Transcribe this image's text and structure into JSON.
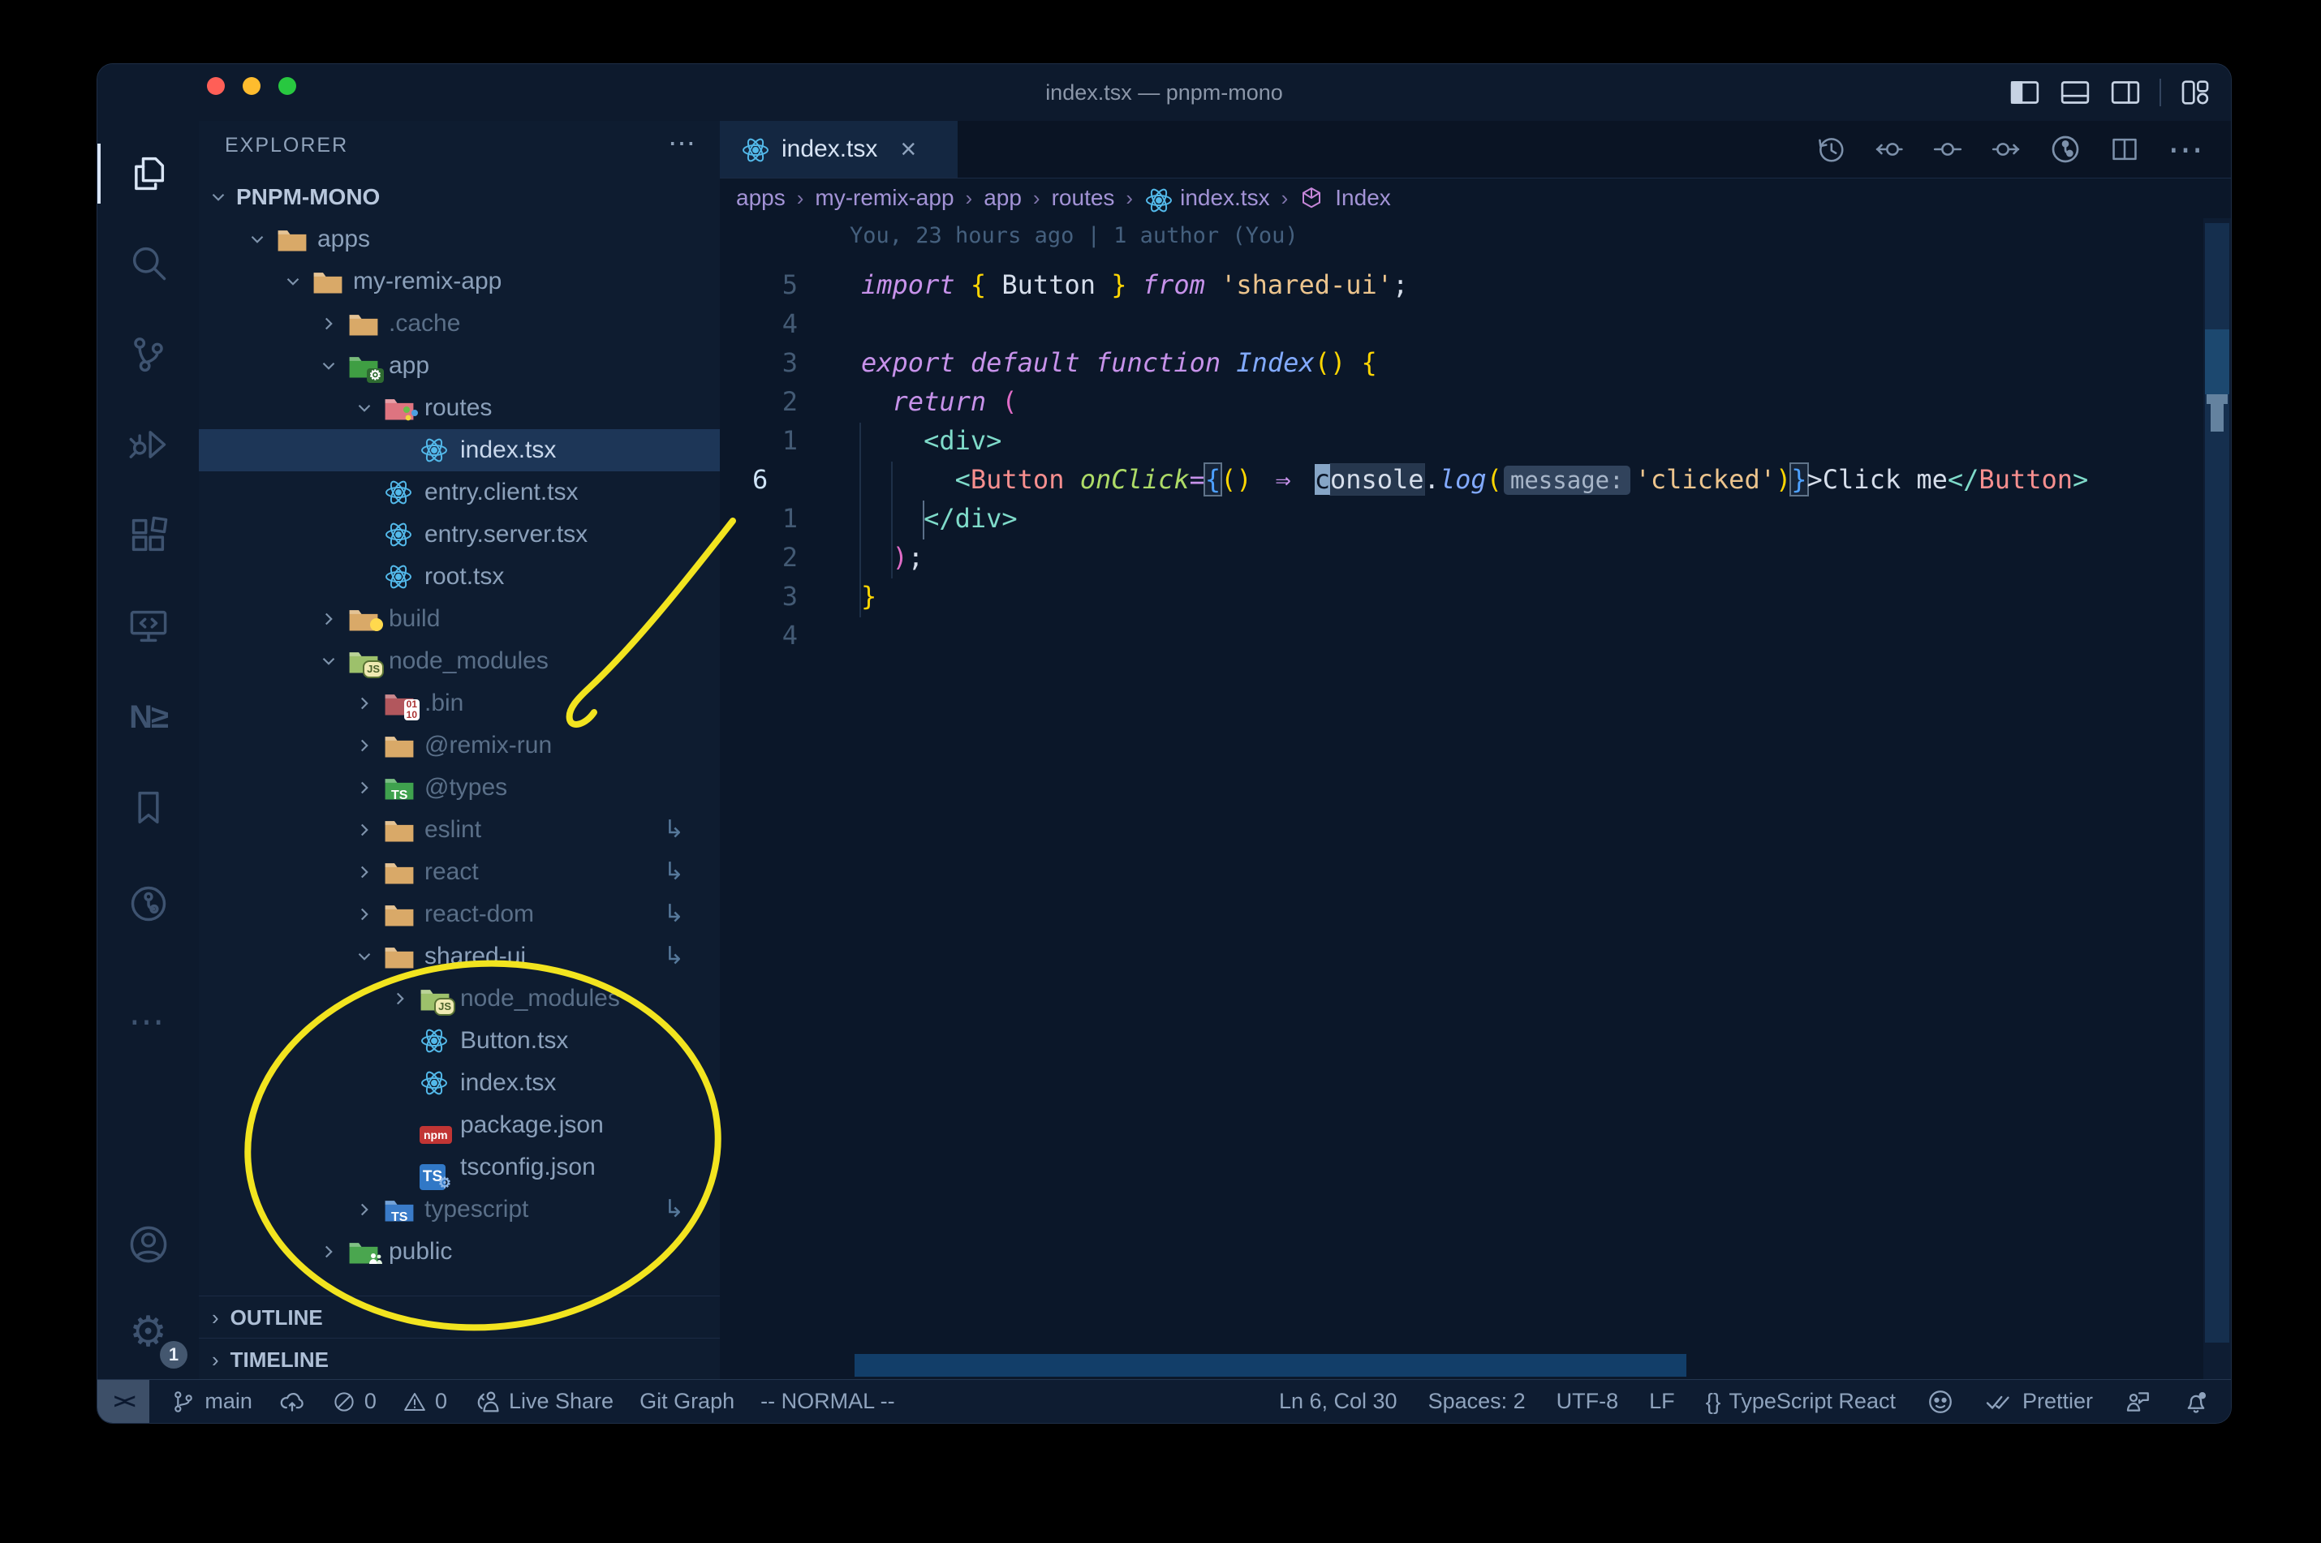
{
  "window": {
    "title": "index.tsx — pnpm-mono"
  },
  "traffic_lights": [
    "#ff5f57",
    "#febc2e",
    "#28c840"
  ],
  "titlebar_layout_icons": [
    "toggle-sidebar",
    "toggle-panel",
    "toggle-secondary-sidebar",
    "sep",
    "customize-layout"
  ],
  "activity_bar": {
    "items": [
      {
        "name": "explorer",
        "active": true
      },
      {
        "name": "search",
        "active": false
      },
      {
        "name": "source-control",
        "active": false
      },
      {
        "name": "run-debug",
        "active": false
      },
      {
        "name": "extensions",
        "active": false
      },
      {
        "name": "remote-explorer",
        "active": false
      },
      {
        "name": "nx-console",
        "active": false
      },
      {
        "name": "bookmarks",
        "active": false
      },
      {
        "name": "gitlens",
        "active": false
      },
      {
        "name": "more",
        "active": false
      }
    ],
    "bottom": [
      {
        "name": "account"
      },
      {
        "name": "settings",
        "badge": "1"
      }
    ]
  },
  "sidebar": {
    "header": "EXPLORER",
    "root_label": "PNPM-MONO",
    "tree": [
      {
        "label": "apps",
        "level": 1,
        "icon": "folder-tan",
        "chevron": "down",
        "dim": false,
        "symlink": false,
        "selected": false
      },
      {
        "label": "my-remix-app",
        "level": 2,
        "icon": "folder-tan",
        "chevron": "down",
        "dim": false,
        "symlink": false,
        "selected": false
      },
      {
        "label": ".cache",
        "level": 3,
        "icon": "folder-tan",
        "chevron": "right",
        "dim": true,
        "symlink": false,
        "selected": false
      },
      {
        "label": "app",
        "level": 3,
        "icon": "folder-app",
        "chevron": "down",
        "dim": false,
        "symlink": false,
        "selected": false
      },
      {
        "label": "routes",
        "level": 4,
        "icon": "folder-routes",
        "chevron": "down",
        "dim": false,
        "symlink": false,
        "selected": false
      },
      {
        "label": "index.tsx",
        "level": 5,
        "icon": "react",
        "chevron": "none",
        "dim": false,
        "symlink": false,
        "selected": true
      },
      {
        "label": "entry.client.tsx",
        "level": 4,
        "icon": "react",
        "chevron": "none",
        "dim": false,
        "symlink": false,
        "selected": false
      },
      {
        "label": "entry.server.tsx",
        "level": 4,
        "icon": "react",
        "chevron": "none",
        "dim": false,
        "symlink": false,
        "selected": false
      },
      {
        "label": "root.tsx",
        "level": 4,
        "icon": "react",
        "chevron": "none",
        "dim": false,
        "symlink": false,
        "selected": false
      },
      {
        "label": "build",
        "level": 3,
        "icon": "folder-build",
        "chevron": "right",
        "dim": true,
        "symlink": false,
        "selected": false
      },
      {
        "label": "node_modules",
        "level": 3,
        "icon": "folder-node",
        "chevron": "down",
        "dim": true,
        "symlink": false,
        "selected": false
      },
      {
        "label": ".bin",
        "level": 4,
        "icon": "folder-bin",
        "chevron": "right",
        "dim": true,
        "symlink": false,
        "selected": false
      },
      {
        "label": "@remix-run",
        "level": 4,
        "icon": "folder-tan",
        "chevron": "right",
        "dim": true,
        "symlink": false,
        "selected": false
      },
      {
        "label": "@types",
        "level": 4,
        "icon": "folder-types",
        "chevron": "right",
        "dim": true,
        "symlink": false,
        "selected": false
      },
      {
        "label": "eslint",
        "level": 4,
        "icon": "folder-tan",
        "chevron": "right",
        "dim": true,
        "symlink": true,
        "selected": false
      },
      {
        "label": "react",
        "level": 4,
        "icon": "folder-tan",
        "chevron": "right",
        "dim": true,
        "symlink": true,
        "selected": false
      },
      {
        "label": "react-dom",
        "level": 4,
        "icon": "folder-tan",
        "chevron": "right",
        "dim": true,
        "symlink": true,
        "selected": false
      },
      {
        "label": "shared-ui",
        "level": 4,
        "icon": "folder-tan",
        "chevron": "down",
        "dim": false,
        "symlink": true,
        "selected": false
      },
      {
        "label": "node_modules",
        "level": 5,
        "icon": "folder-node",
        "chevron": "right",
        "dim": true,
        "symlink": false,
        "selected": false
      },
      {
        "label": "Button.tsx",
        "level": 5,
        "icon": "react",
        "chevron": "none",
        "dim": false,
        "symlink": false,
        "selected": false
      },
      {
        "label": "index.tsx",
        "level": 5,
        "icon": "react",
        "chevron": "none",
        "dim": false,
        "symlink": false,
        "selected": false
      },
      {
        "label": "package.json",
        "level": 5,
        "icon": "npm",
        "chevron": "none",
        "dim": false,
        "symlink": false,
        "selected": false
      },
      {
        "label": "tsconfig.json",
        "level": 5,
        "icon": "tsconfig",
        "chevron": "none",
        "dim": false,
        "symlink": false,
        "selected": false
      },
      {
        "label": "typescript",
        "level": 4,
        "icon": "folder-ts",
        "chevron": "right",
        "dim": true,
        "symlink": true,
        "selected": false
      },
      {
        "label": "public",
        "level": 3,
        "icon": "folder-public",
        "chevron": "right",
        "dim": false,
        "symlink": false,
        "selected": false
      }
    ],
    "sections": [
      "OUTLINE",
      "TIMELINE"
    ]
  },
  "editor": {
    "tab": {
      "label": "index.tsx",
      "icon": "react",
      "close": "×"
    },
    "actions": [
      "history",
      "commit-left",
      "commit",
      "commit-right",
      "gitlens-graph",
      "split-editor",
      "more"
    ],
    "breadcrumbs": [
      {
        "label": "apps",
        "icon": ""
      },
      {
        "label": "my-remix-app",
        "icon": ""
      },
      {
        "label": "app",
        "icon": ""
      },
      {
        "label": "routes",
        "icon": ""
      },
      {
        "label": "index.tsx",
        "icon": "react"
      },
      {
        "label": "Index",
        "icon": "symbol-module"
      }
    ],
    "blame": "You, 23 hours ago | 1 author (You)",
    "code": {
      "gutter": [
        "5",
        "4",
        "3",
        "2",
        "1",
        "6",
        "1",
        "2",
        "3",
        "4"
      ],
      "current_index": 5,
      "lines": [
        [
          [
            "import",
            "kw"
          ],
          [
            " ",
            "w"
          ],
          [
            "{",
            "g"
          ],
          [
            " ",
            "w"
          ],
          [
            "Button",
            "w"
          ],
          [
            " ",
            "w"
          ],
          [
            "}",
            "g"
          ],
          [
            " ",
            "w"
          ],
          [
            "from",
            "kw"
          ],
          [
            " ",
            "w"
          ],
          [
            "'shared-ui'",
            "s"
          ],
          [
            ";",
            "w"
          ]
        ],
        [],
        [
          [
            "export",
            "kw"
          ],
          [
            " ",
            "w"
          ],
          [
            "default",
            "kw"
          ],
          [
            " ",
            "w"
          ],
          [
            "function",
            "kw"
          ],
          [
            " ",
            "w"
          ],
          [
            "Index",
            "fn"
          ],
          [
            "()",
            "g"
          ],
          [
            " ",
            "w"
          ],
          [
            "{",
            "g"
          ]
        ],
        [
          [
            "  ",
            "w"
          ],
          [
            "return",
            "kw"
          ],
          [
            " ",
            "w"
          ],
          [
            "(",
            "p"
          ]
        ],
        [
          [
            "    ",
            "w"
          ],
          [
            "<div>",
            "tg"
          ]
        ],
        [
          [
            "      ",
            "w"
          ],
          [
            "<",
            "tg"
          ],
          [
            "Button",
            "cm"
          ],
          [
            " ",
            "w"
          ],
          [
            "onClick",
            "at"
          ],
          [
            "=",
            "pu"
          ],
          [
            "{",
            "bx"
          ],
          [
            "()",
            "g"
          ],
          [
            " ",
            "w"
          ],
          [
            "⇒",
            "ar"
          ],
          [
            " ",
            "w"
          ],
          [
            "c",
            "cur"
          ],
          [
            "onsole",
            "hl"
          ],
          [
            ".",
            "w"
          ],
          [
            "log",
            "fn"
          ],
          [
            "(",
            "g"
          ],
          [
            "message:",
            "in"
          ],
          [
            "'clicked'",
            "s"
          ],
          [
            ")",
            "g"
          ],
          [
            "}",
            "bx"
          ],
          [
            ">",
            "w"
          ],
          [
            "Click me",
            "w"
          ],
          [
            "</",
            "tg"
          ],
          [
            "Button",
            "cm"
          ],
          [
            ">",
            "tg"
          ]
        ],
        [
          [
            "    ",
            "w"
          ],
          [
            "</div>",
            "tg"
          ]
        ],
        [
          [
            "  ",
            "w"
          ],
          [
            ")",
            "p"
          ],
          [
            ";",
            "w"
          ]
        ],
        [
          [
            "}",
            "g"
          ]
        ],
        []
      ]
    }
  },
  "status_bar": {
    "left": [
      {
        "icon": "remote",
        "label": "",
        "boxed": true
      },
      {
        "icon": "branch",
        "label": "main",
        "boxed": false
      },
      {
        "icon": "cloud-up",
        "label": "",
        "boxed": false
      },
      {
        "icon": "error",
        "label": "0",
        "boxed": false
      },
      {
        "icon": "warning",
        "label": "0",
        "boxed": false
      },
      {
        "icon": "live-share",
        "label": "Live Share",
        "boxed": false
      },
      {
        "icon": "",
        "label": "Git Graph",
        "boxed": false
      },
      {
        "icon": "",
        "label": "-- NORMAL --",
        "boxed": false
      }
    ],
    "right": [
      {
        "icon": "",
        "label": "Ln 6, Col 30"
      },
      {
        "icon": "",
        "label": "Spaces: 2"
      },
      {
        "icon": "",
        "label": "UTF-8"
      },
      {
        "icon": "",
        "label": "LF"
      },
      {
        "icon": "braces",
        "label": "TypeScript React"
      },
      {
        "icon": "octoface",
        "label": ""
      },
      {
        "icon": "double-check",
        "label": "Prettier"
      },
      {
        "icon": "feedback",
        "label": ""
      },
      {
        "icon": "bell-dot",
        "label": ""
      }
    ]
  },
  "annotation_color": "#f2e41f"
}
